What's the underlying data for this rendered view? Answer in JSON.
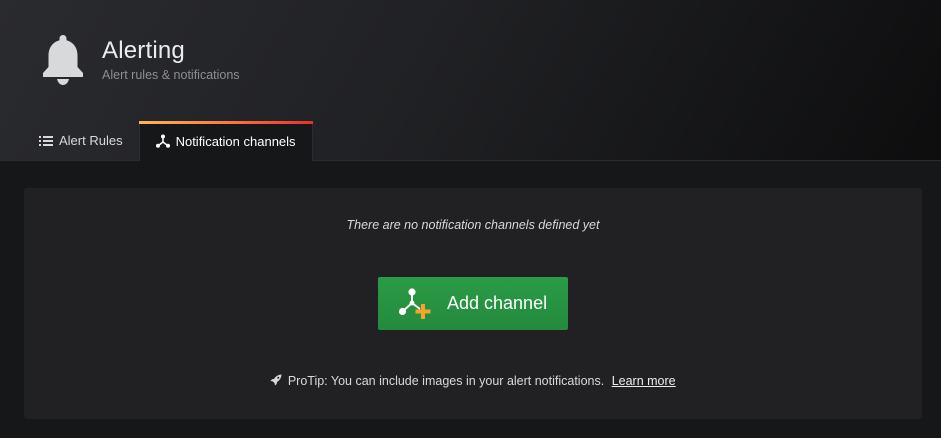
{
  "header": {
    "title": "Alerting",
    "subtitle": "Alert rules & notifications",
    "icon": "bell-icon"
  },
  "tabs": [
    {
      "label": "Alert Rules",
      "icon": "list-icon",
      "active": false
    },
    {
      "label": "Notification channels",
      "icon": "share-nodes-icon",
      "active": true
    }
  ],
  "empty_state": {
    "message": "There are no notification channels defined yet",
    "button_label": "Add channel",
    "button_icon": "add-channel-icon",
    "protip": "ProTip: You can include images in your alert notifications.",
    "learn_more": "Learn more"
  },
  "colors": {
    "button_green": "#299c46",
    "tab_accent_start": "#ffb357",
    "tab_accent_end": "#eb2d2d",
    "plus_orange": "#f7a32c"
  }
}
